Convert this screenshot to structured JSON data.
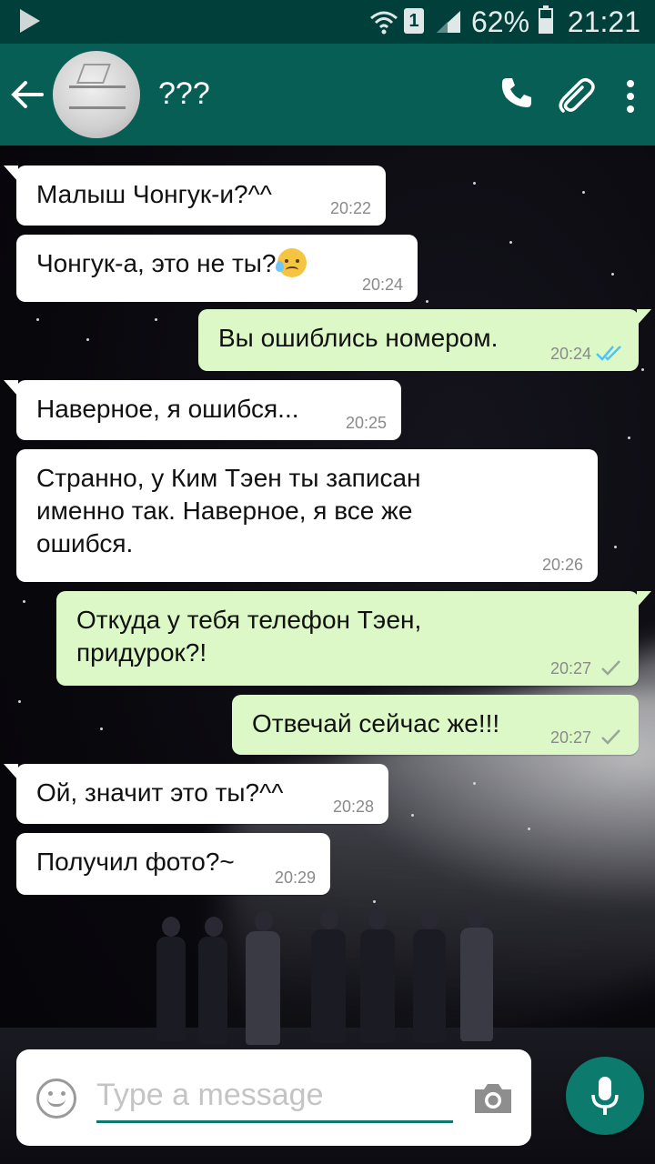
{
  "status_bar": {
    "battery": "62%",
    "time": "21:21",
    "sim_label": "1"
  },
  "header": {
    "contact_name": "???"
  },
  "messages": [
    {
      "direction": "incoming",
      "text": "Малыш Чонгук-и?^^",
      "time": "20:22"
    },
    {
      "direction": "incoming",
      "text": "Чонгук-а, это не ты?",
      "time": "20:24",
      "emoji": "sad-tear-face"
    },
    {
      "direction": "outgoing",
      "text": "Вы ошиблись номером.",
      "time": "20:24",
      "status": "read"
    },
    {
      "direction": "incoming",
      "text": "Наверное, я ошибся...",
      "time": "20:25"
    },
    {
      "direction": "incoming",
      "text": "Странно, у Ким Тэен ты записан\nименно так. Наверное, я все же\nошибся.",
      "time": "20:26"
    },
    {
      "direction": "outgoing",
      "text": "Откуда у тебя телефон Тэен,\nпридурок?!",
      "time": "20:27",
      "status": "sent"
    },
    {
      "direction": "outgoing",
      "text": "Отвечай сейчас же!!!",
      "time": "20:27",
      "status": "sent"
    },
    {
      "direction": "incoming",
      "text": "Ой, значит это ты?^^",
      "time": "20:28"
    },
    {
      "direction": "incoming",
      "text": "Получил фото?~",
      "time": "20:29"
    }
  ],
  "composer": {
    "placeholder": "Type a message"
  },
  "colors": {
    "status_bar": "#003f3a",
    "app_bar": "#075e54",
    "incoming_bubble": "#ffffff",
    "outgoing_bubble": "#dcf8c6",
    "read_tick": "#4fc3f7",
    "sent_tick": "#9aa59a",
    "accent": "#0c7a6c"
  }
}
